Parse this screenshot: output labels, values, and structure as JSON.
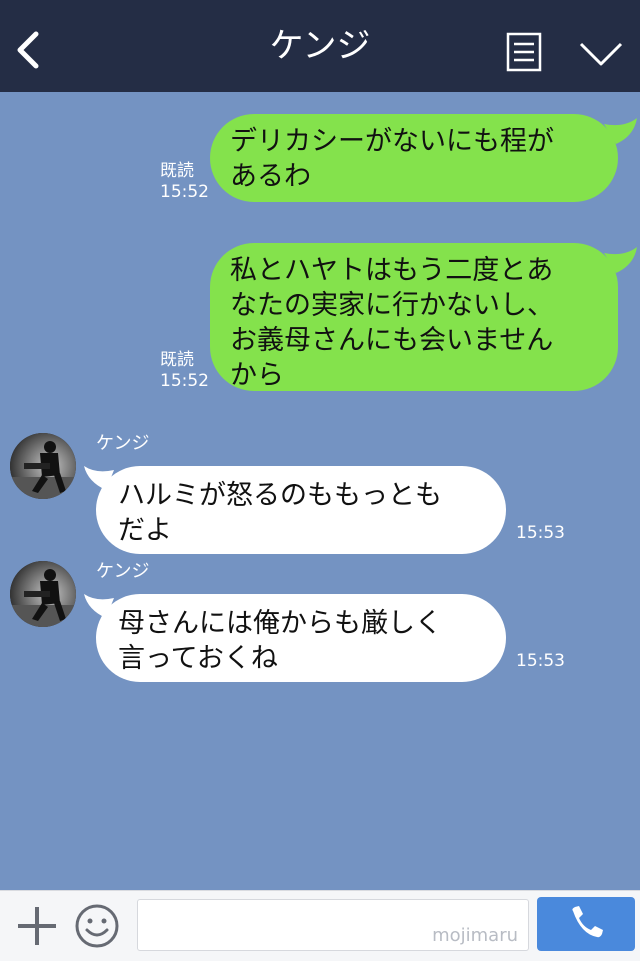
{
  "header": {
    "title": "ケンジ",
    "icons": [
      "back-arrow-icon",
      "note-icon",
      "chevron-down-icon"
    ],
    "background": "#242d45"
  },
  "chat": {
    "background": "#7493c2",
    "messages": [
      {
        "direction": "outgoing",
        "text": "デリカシーがないにも程が\nあるわ",
        "read_label": "既読",
        "time": "15:52"
      },
      {
        "direction": "outgoing",
        "text": "私とハヤトはもう二度とあ\nなたの実家に行かないし、\nお義母さんにも会いません\nから",
        "read_label": "既読",
        "time": "15:52"
      },
      {
        "direction": "incoming",
        "sender": "ケンジ",
        "text": "ハルミが怒るのももっとも\nだよ",
        "time": "15:53"
      },
      {
        "direction": "incoming",
        "sender": "ケンジ",
        "text": "母さんには俺からも厳しく\n言っておくね",
        "time": "15:53"
      }
    ],
    "outgoing_color": "#84e24c",
    "incoming_color": "#ffffff"
  },
  "footer": {
    "icons": [
      "plus-icon",
      "emoji-icon",
      "phone-icon"
    ],
    "input_placeholder": "",
    "watermark": "mojimaru",
    "call_button_color": "#4a89dc"
  }
}
